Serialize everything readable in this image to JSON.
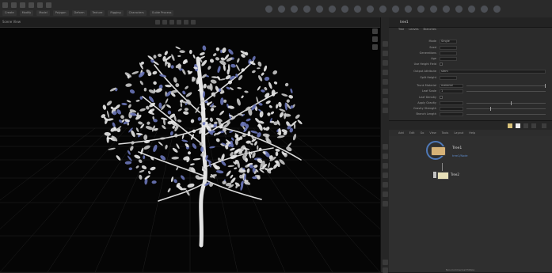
{
  "app": {
    "shelf_tabs": [
      "Create",
      "Modify",
      "Model",
      "Polygon",
      "Deform",
      "Texture",
      "Rigging",
      "Characters",
      "Guide Process"
    ],
    "viewport_tab": "Scene View"
  },
  "params": {
    "node_path": "tree1",
    "tabs": [
      "Tree",
      "Leaves",
      "Branches"
    ],
    "rows": [
      {
        "label": "Mode",
        "value": "Single"
      },
      {
        "label": "Seed",
        "value": ""
      },
      {
        "label": "Generations",
        "value": ""
      },
      {
        "label": "Age",
        "value": ""
      },
      {
        "label": "Use Height Field",
        "value": ""
      },
      {
        "label": "Output Attribute",
        "value": "stem"
      },
      {
        "label": "Split Height",
        "value": ""
      },
      {
        "label": "Trunk Material",
        "value": "material"
      },
      {
        "label": "Leaf Scale",
        "value": "1"
      },
      {
        "label": "Leaf Density",
        "value": ""
      },
      {
        "label": "Apply Gravity",
        "value": ""
      },
      {
        "label": "Gravity Strength",
        "value": ""
      },
      {
        "label": "Branch Length",
        "value": ""
      }
    ]
  },
  "network": {
    "menu": [
      "Add",
      "Edit",
      "Go",
      "View",
      "Tools",
      "Layout",
      "Help"
    ],
    "geo_node": {
      "name": "Tree1",
      "subtitle": "tree1/Node"
    },
    "sel_node": {
      "name": "Tree2"
    },
    "footer": "Non-Commercial Edition"
  },
  "colors": {
    "viewport_bg": "#050505",
    "grid": "#2a2a2a",
    "tree_bark": "#e4e4e4",
    "leaf_tint": "#6a76b8",
    "node_geo": "#d6b277",
    "node_ring": "#4f79b8"
  }
}
